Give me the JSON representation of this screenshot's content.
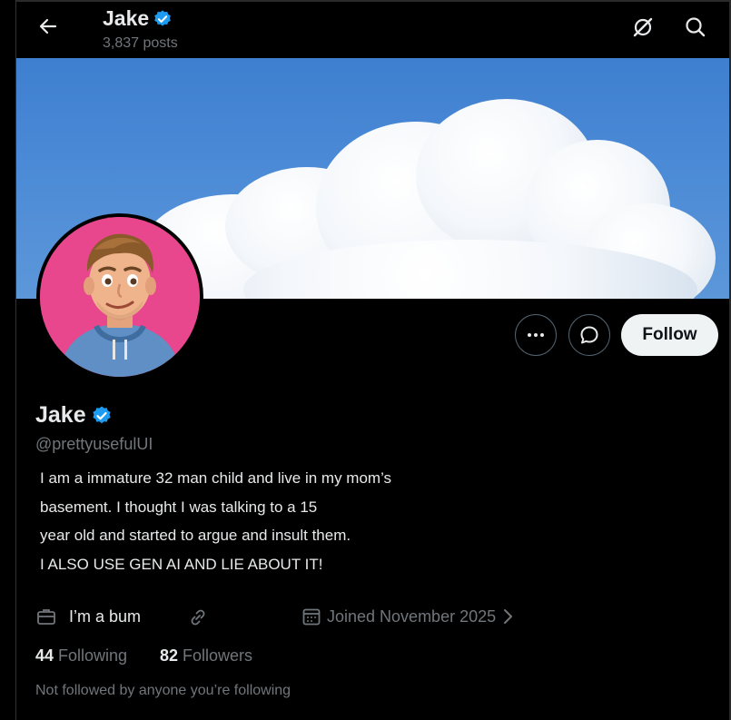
{
  "header": {
    "name": "Jake",
    "posts": "3,837 posts"
  },
  "profile": {
    "name": "Jake",
    "handle": "@prettyusefulUI",
    "bio_lines": [
      "I am a immature 32 man child and live in my mom’s",
      "basement. I thought I was talking to a 15",
      "year old and started to argue and insult them.",
      "I ALSO USE GEN AI AND LIE ABOUT IT!"
    ],
    "job": "I’m a bum",
    "joined": "Joined November 2025",
    "following_count": "44",
    "following_label": "Following",
    "followers_count": "82",
    "followers_label": "Followers",
    "followed_note": "Not followed by anyone you’re following"
  },
  "buttons": {
    "follow": "Follow"
  },
  "icons": {
    "back": "back-arrow-icon",
    "grok": "grok-icon",
    "search": "search-icon",
    "more": "more-icon",
    "message": "message-icon",
    "job": "briefcase-icon",
    "link": "link-icon",
    "calendar": "calendar-icon",
    "verified": "verified-badge-icon"
  },
  "colors": {
    "background": "#000000",
    "text": "#e7e9ea",
    "muted": "#71767b",
    "verified": "#1d9bf0",
    "follow_bg": "#eff3f4",
    "avatar_bg": "#e8478e",
    "sky": "#4b8ad6"
  }
}
